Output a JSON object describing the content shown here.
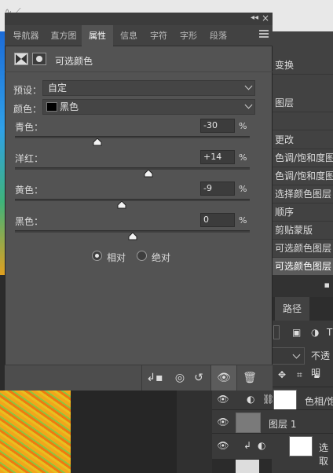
{
  "panel": {
    "tabs": [
      "导航器",
      "直方图",
      "属性",
      "信息",
      "字符",
      "字形",
      "段落"
    ],
    "active_tab": "属性",
    "title": "可选颜色",
    "preset_label": "预设：",
    "preset_value": "自定",
    "colors_label": "颜色：",
    "colors_value": "黑色",
    "sliders": [
      {
        "label": "青色：",
        "value": "-30",
        "unit": "%",
        "level": -30
      },
      {
        "label": "洋红：",
        "value": "+14",
        "unit": "%",
        "level": 14
      },
      {
        "label": "黄色：",
        "value": "-9",
        "unit": "%",
        "level": -9
      },
      {
        "label": "黑色：",
        "value": "0",
        "unit": "%",
        "level": 0
      }
    ],
    "method": {
      "relative": "相对",
      "absolute": "绝对",
      "selected": "relative"
    },
    "collapse_glyph": "◂◂",
    "close_glyph": "×"
  },
  "history": {
    "items": [
      "变换",
      "图层",
      "",
      "更改",
      "色调/饱和度图层",
      "色调/饱和度图层",
      "选择颜色图层",
      "顺序",
      "剪贴蒙版",
      "可选颜色图层",
      "可选颜色图层"
    ],
    "selected_index": 10
  },
  "layers": {
    "paths_tab": "路径",
    "opacity_label": "不透明",
    "rows": [
      {
        "name": "色相/饱"
      },
      {
        "name": "图层 1"
      },
      {
        "name": "选取"
      }
    ]
  },
  "colors": {
    "panel_bg": "#535353",
    "accent_white": "#ffffff"
  }
}
